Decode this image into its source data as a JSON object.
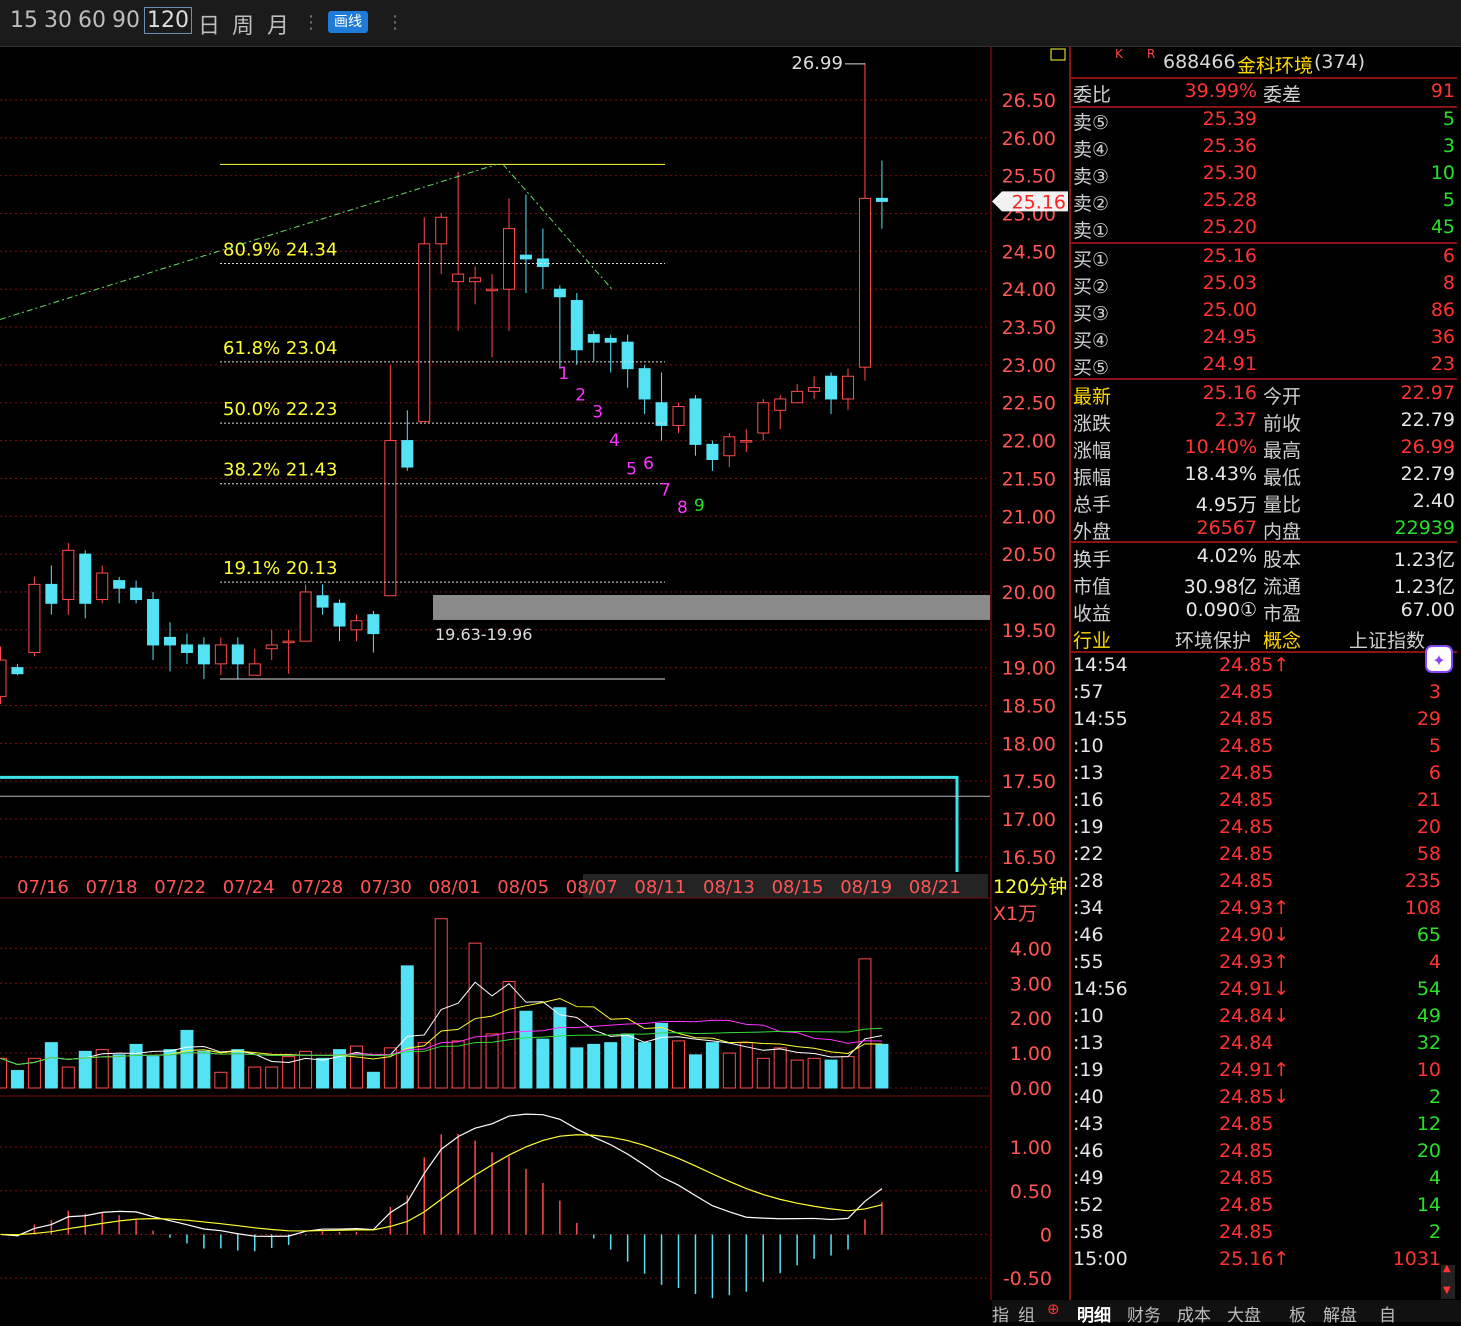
{
  "toolbar": {
    "timeframes": [
      "15",
      "30",
      "60",
      "90",
      "120",
      "日",
      "周",
      "月"
    ],
    "selected": "120",
    "draw_button": "画线"
  },
  "colors": {
    "up": "#ff4a4a",
    "down": "#54e3f4",
    "yellow": "#ffff33",
    "grid": "#7a1010",
    "label_red": "#ff3333",
    "green": "#27e027",
    "magenta": "#ff33ff"
  },
  "chart_data": [
    {
      "type": "candlestick",
      "period_label": "120分钟",
      "dates": [
        "07/16",
        "07/18",
        "07/22",
        "07/24",
        "07/28",
        "07/30",
        "08/01",
        "08/05",
        "08/07",
        "08/11",
        "08/13",
        "08/15",
        "08/19",
        "08/21"
      ],
      "y_ticks": [
        "26.50",
        "26.00",
        "25.50",
        "25.00",
        "24.50",
        "24.00",
        "23.50",
        "23.00",
        "22.50",
        "22.00",
        "21.50",
        "21.00",
        "20.50",
        "20.00",
        "19.50",
        "19.00",
        "18.50",
        "18.00",
        "17.50",
        "17.00",
        "16.50"
      ],
      "ylim": [
        16.3,
        27.2
      ],
      "candles": [
        [
          18.62,
          19.1,
          18.52,
          19.28
        ],
        [
          19.0,
          18.92,
          18.9,
          19.05
        ],
        [
          19.2,
          20.1,
          19.15,
          20.2
        ],
        [
          20.1,
          19.85,
          19.7,
          20.35
        ],
        [
          19.9,
          20.55,
          19.7,
          20.65
        ],
        [
          20.5,
          19.85,
          19.65,
          20.55
        ],
        [
          19.9,
          20.25,
          19.85,
          20.35
        ],
        [
          20.15,
          20.05,
          19.85,
          20.2
        ],
        [
          20.05,
          19.9,
          19.85,
          20.15
        ],
        [
          19.9,
          19.3,
          19.1,
          20.0
        ],
        [
          19.4,
          19.3,
          18.95,
          19.6
        ],
        [
          19.3,
          19.2,
          19.05,
          19.45
        ],
        [
          19.3,
          19.05,
          18.85,
          19.4
        ],
        [
          19.05,
          19.3,
          18.9,
          19.4
        ],
        [
          19.3,
          19.05,
          18.85,
          19.4
        ],
        [
          18.9,
          19.05,
          18.9,
          19.25
        ],
        [
          19.25,
          19.3,
          19.1,
          19.5
        ],
        [
          19.35,
          19.35,
          18.92,
          19.5
        ],
        [
          19.35,
          20.0,
          19.35,
          20.1
        ],
        [
          19.95,
          19.8,
          19.7,
          20.1
        ],
        [
          19.85,
          19.55,
          19.35,
          19.9
        ],
        [
          19.5,
          19.62,
          19.35,
          19.7
        ],
        [
          19.7,
          19.45,
          19.2,
          19.75
        ],
        [
          19.95,
          22.0,
          19.95,
          23.0
        ],
        [
          22.0,
          21.65,
          21.6,
          22.4
        ],
        [
          22.25,
          24.6,
          22.25,
          24.95
        ],
        [
          24.6,
          24.95,
          24.2,
          25.0
        ],
        [
          24.1,
          24.2,
          23.45,
          25.55
        ],
        [
          24.1,
          24.15,
          23.8,
          24.3
        ],
        [
          24.0,
          24.0,
          23.1,
          24.2
        ],
        [
          24.0,
          24.8,
          23.45,
          25.2
        ],
        [
          24.45,
          24.4,
          23.95,
          25.25
        ],
        [
          24.4,
          24.3,
          24.0,
          24.8
        ],
        [
          24.0,
          23.9,
          22.95,
          24.05
        ],
        [
          23.85,
          23.2,
          23.0,
          23.95
        ],
        [
          23.4,
          23.3,
          23.05,
          23.45
        ],
        [
          23.35,
          23.3,
          22.9,
          23.4
        ],
        [
          23.3,
          22.95,
          22.7,
          23.4
        ],
        [
          22.95,
          22.55,
          22.35,
          23.0
        ],
        [
          22.5,
          22.2,
          22.0,
          22.9
        ],
        [
          22.2,
          22.45,
          22.1,
          22.5
        ],
        [
          22.55,
          21.95,
          21.8,
          22.6
        ],
        [
          21.95,
          21.75,
          21.6,
          22.0
        ],
        [
          21.8,
          22.05,
          21.65,
          22.1
        ],
        [
          22.0,
          22.0,
          21.85,
          22.15
        ],
        [
          22.1,
          22.5,
          22.0,
          22.55
        ],
        [
          22.4,
          22.55,
          22.15,
          22.6
        ],
        [
          22.5,
          22.65,
          22.5,
          22.75
        ],
        [
          22.65,
          22.7,
          22.55,
          22.85
        ],
        [
          22.85,
          22.55,
          22.35,
          22.9
        ],
        [
          22.55,
          22.85,
          22.4,
          22.95
        ],
        [
          22.97,
          25.2,
          22.79,
          26.99
        ],
        [
          25.2,
          25.16,
          24.8,
          25.7
        ]
      ],
      "fib_levels": [
        {
          "label": "80.9% 24.34",
          "value": 24.34
        },
        {
          "label": "61.8% 23.04",
          "value": 23.04
        },
        {
          "label": "50.0% 22.23",
          "value": 22.23
        },
        {
          "label": "38.2% 21.43",
          "value": 21.43
        },
        {
          "label": "19.1% 20.13",
          "value": 20.13
        }
      ],
      "fib_high": 25.65,
      "fib_low": 18.85,
      "zone": {
        "label": "19.63-19.96",
        "low": 19.63,
        "high": 19.96
      },
      "high_label": "26.99",
      "current_price": "25.16",
      "td_count": [
        "1",
        "2",
        "3",
        "4",
        "5",
        "6",
        "7",
        "8",
        "9"
      ],
      "cyan_level": 17.55,
      "gray_level": 17.3
    },
    {
      "type": "bar",
      "name": "volume",
      "unit_label": "X1万",
      "y_ticks": [
        "4.00",
        "3.00",
        "2.00",
        "1.00",
        "0.00"
      ],
      "ylim": [
        0,
        4.9
      ],
      "values": [
        0.85,
        0.5,
        0.85,
        1.3,
        0.6,
        1.05,
        1.1,
        0.95,
        1.25,
        0.9,
        1.1,
        1.65,
        1.05,
        0.45,
        1.1,
        0.6,
        0.6,
        0.9,
        1.05,
        0.85,
        1.1,
        1.2,
        0.45,
        1.15,
        3.5,
        1.3,
        4.85,
        1.35,
        4.15,
        1.55,
        3.05,
        2.2,
        1.4,
        2.3,
        1.15,
        1.25,
        1.3,
        1.55,
        1.3,
        1.85,
        1.35,
        0.95,
        1.3,
        1.0,
        1.3,
        0.85,
        1.15,
        0.8,
        0.85,
        0.8,
        0.9,
        3.7,
        1.25
      ]
    },
    {
      "type": "line",
      "name": "macd",
      "y_ticks": [
        "1.00",
        "0.50",
        "0",
        "-0.50"
      ],
      "ylim": [
        -0.75,
        1.55
      ]
    }
  ],
  "panel": {
    "k_label": "K",
    "r_label": "R",
    "code": "688466",
    "name": "金科环境",
    "suffix": "(374)",
    "weibi_label": "委比",
    "weibi": "39.99%",
    "weicha_label": "委差",
    "weicha": "91",
    "sells": [
      {
        "label": "卖⑤",
        "price": "25.39",
        "vol": "5"
      },
      {
        "label": "卖④",
        "price": "25.36",
        "vol": "3"
      },
      {
        "label": "卖③",
        "price": "25.30",
        "vol": "10"
      },
      {
        "label": "卖②",
        "price": "25.28",
        "vol": "5"
      },
      {
        "label": "卖①",
        "price": "25.20",
        "vol": "45"
      }
    ],
    "buys": [
      {
        "label": "买①",
        "price": "25.16",
        "vol": "6"
      },
      {
        "label": "买②",
        "price": "25.03",
        "vol": "8"
      },
      {
        "label": "买③",
        "price": "25.00",
        "vol": "86"
      },
      {
        "label": "买④",
        "price": "24.95",
        "vol": "36"
      },
      {
        "label": "买⑤",
        "price": "24.91",
        "vol": "23"
      }
    ],
    "stats": [
      {
        "l1": "最新",
        "v1": "25.16",
        "l2": "今开",
        "v2": "22.97",
        "c1": "r",
        "c2": "r"
      },
      {
        "l1": "涨跌",
        "v1": "2.37",
        "l2": "前收",
        "v2": "22.79",
        "c1": "r",
        "c2": "w"
      },
      {
        "l1": "涨幅",
        "v1": "10.40%",
        "l2": "最高",
        "v2": "26.99",
        "c1": "r",
        "c2": "r"
      },
      {
        "l1": "振幅",
        "v1": "18.43%",
        "l2": "最低",
        "v2": "22.79",
        "c1": "w",
        "c2": "w"
      },
      {
        "l1": "总手",
        "v1": "4.95万",
        "l2": "量比",
        "v2": "2.40",
        "c1": "w",
        "c2": "w"
      },
      {
        "l1": "外盘",
        "v1": "26567",
        "l2": "内盘",
        "v2": "22939",
        "c1": "r",
        "c2": "g"
      }
    ],
    "info": [
      {
        "l1": "换手",
        "v1": "4.02%",
        "l2": "股本",
        "v2": "1.23亿"
      },
      {
        "l1": "市值",
        "v1": "30.98亿",
        "l2": "流通",
        "v2": "1.23亿"
      },
      {
        "l1": "收益",
        "v1": "0.090①",
        "l2": "市盈",
        "v2": "67.00"
      },
      {
        "l1": "行业",
        "v1": "环境保护",
        "l2": "概念",
        "v2": "上证指数"
      }
    ],
    "ticks": [
      {
        "t": "14:54",
        "p": "24.85↑",
        "v": "",
        "pc": "r",
        "vc": "r"
      },
      {
        "t": ":57",
        "p": "24.85",
        "v": "3",
        "pc": "r",
        "vc": "r"
      },
      {
        "t": "14:55",
        "p": "24.85",
        "v": "29",
        "pc": "r",
        "vc": "r"
      },
      {
        "t": ":10",
        "p": "24.85",
        "v": "5",
        "pc": "r",
        "vc": "r"
      },
      {
        "t": ":13",
        "p": "24.85",
        "v": "6",
        "pc": "r",
        "vc": "r"
      },
      {
        "t": ":16",
        "p": "24.85",
        "v": "21",
        "pc": "r",
        "vc": "r"
      },
      {
        "t": ":19",
        "p": "24.85",
        "v": "20",
        "pc": "r",
        "vc": "r"
      },
      {
        "t": ":22",
        "p": "24.85",
        "v": "58",
        "pc": "r",
        "vc": "r"
      },
      {
        "t": ":28",
        "p": "24.85",
        "v": "235",
        "pc": "r",
        "vc": "r"
      },
      {
        "t": ":34",
        "p": "24.93↑",
        "v": "108",
        "pc": "r",
        "vc": "r"
      },
      {
        "t": ":46",
        "p": "24.90↓",
        "v": "65",
        "pc": "r",
        "vc": "g"
      },
      {
        "t": ":55",
        "p": "24.93↑",
        "v": "4",
        "pc": "r",
        "vc": "r"
      },
      {
        "t": "14:56",
        "p": "24.91↓",
        "v": "54",
        "pc": "r",
        "vc": "g"
      },
      {
        "t": ":10",
        "p": "24.84↓",
        "v": "49",
        "pc": "r",
        "vc": "g"
      },
      {
        "t": ":13",
        "p": "24.84",
        "v": "32",
        "pc": "r",
        "vc": "g"
      },
      {
        "t": ":19",
        "p": "24.91↑",
        "v": "10",
        "pc": "r",
        "vc": "r"
      },
      {
        "t": ":40",
        "p": "24.85↓",
        "v": "2",
        "pc": "r",
        "vc": "g"
      },
      {
        "t": ":43",
        "p": "24.85",
        "v": "12",
        "pc": "r",
        "vc": "g"
      },
      {
        "t": ":46",
        "p": "24.85",
        "v": "20",
        "pc": "r",
        "vc": "g"
      },
      {
        "t": ":49",
        "p": "24.85",
        "v": "4",
        "pc": "r",
        "vc": "g"
      },
      {
        "t": ":52",
        "p": "24.85",
        "v": "14",
        "pc": "r",
        "vc": "g"
      },
      {
        "t": ":58",
        "p": "24.85",
        "v": "2",
        "pc": "r",
        "vc": "g"
      },
      {
        "t": "15:00",
        "p": "25.16↑",
        "v": "1031",
        "pc": "r",
        "vc": "r"
      }
    ]
  },
  "bottom_tabs": [
    "明细",
    "财务",
    "成本",
    "大盘",
    "板",
    "解盘",
    "自"
  ],
  "left_bottom": {
    "a": "指",
    "b": "组"
  }
}
